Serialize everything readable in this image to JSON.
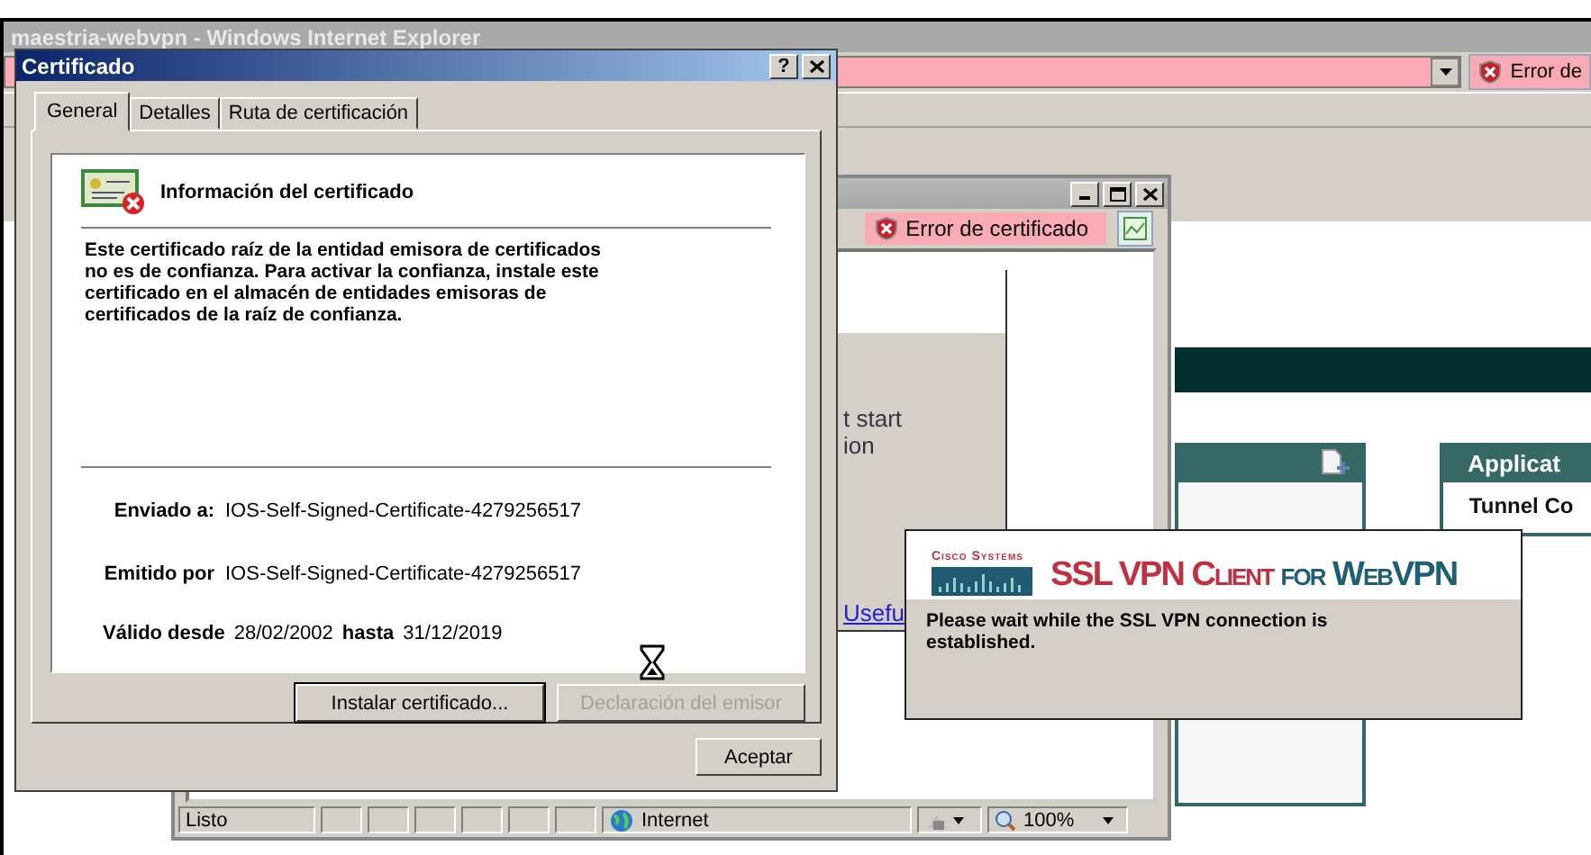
{
  "browser_window": {
    "title": "maestria-webvpn - Windows Internet Explorer",
    "address_status": "Error de",
    "page": {
      "side_panel": {
        "title": "Applicat",
        "row": "Tunnel Co"
      }
    }
  },
  "inner_browser": {
    "address_status": "Error de certificado",
    "page_lines": [
      "t start",
      "ion"
    ],
    "link": "Usefu",
    "status_bar": {
      "text": "Listo",
      "zone": "Internet",
      "zoom": "100%"
    }
  },
  "certificate_dialog": {
    "title": "Certificado",
    "help": "?",
    "tabs": [
      {
        "label": "General",
        "selected": true
      },
      {
        "label": "Detalles",
        "selected": false
      },
      {
        "label": "Ruta de certificación",
        "selected": false
      }
    ],
    "heading": "Información del certificado",
    "message": "Este certificado raíz de la entidad emisora de certificados no es de confianza. Para activar la confianza, instale este certificado en el almacén de entidades emisoras de certificados de la raíz de confianza.",
    "fields": [
      {
        "label": "Enviado a:",
        "value": "IOS-Self-Signed-Certificate-4279256517"
      },
      {
        "label": "Emitido por",
        "value": "IOS-Self-Signed-Certificate-4279256517"
      }
    ],
    "validity": {
      "from_label": "Válido desde",
      "from": "28/02/2002",
      "to_label": "hasta",
      "to": "31/12/2019"
    },
    "buttons": [
      {
        "label": "Instalar certificado...",
        "disabled": false
      },
      {
        "label": "Declaración del emisor",
        "disabled": true
      }
    ],
    "ok_button": "Aceptar"
  },
  "vpn_popup": {
    "brand": "Cisco Systems",
    "product": "SSL VPN Client",
    "product_suffix": "for WebVPN",
    "message": "Please wait while the SSL VPN connection is established."
  }
}
